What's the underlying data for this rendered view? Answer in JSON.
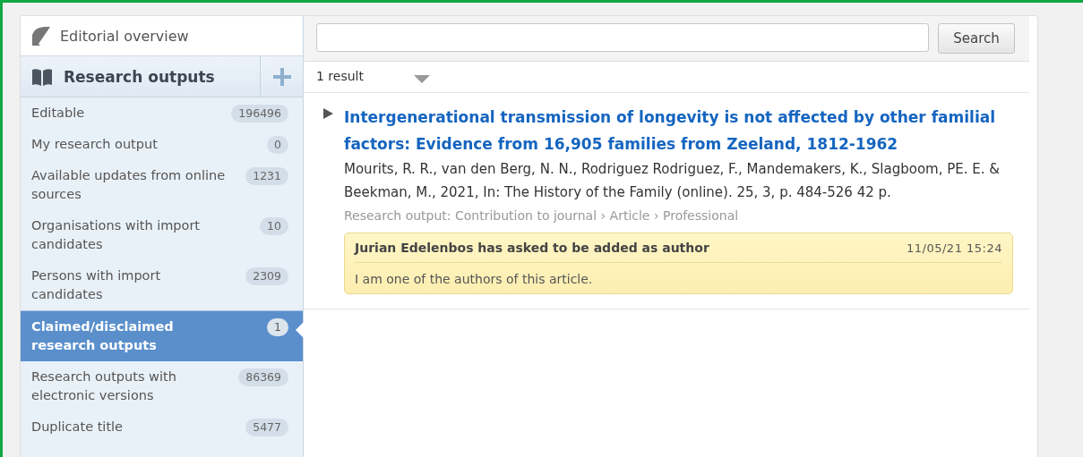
{
  "sidebar": {
    "overview": {
      "label": "Editorial overview"
    },
    "section": {
      "title": "Research outputs"
    },
    "items": [
      {
        "label": "Editable",
        "count": "196496",
        "selected": false
      },
      {
        "label": "My research output",
        "count": "0",
        "selected": false
      },
      {
        "label": "Available updates from online sources",
        "count": "1231",
        "selected": false
      },
      {
        "label": "Organisations with import candidates",
        "count": "10",
        "selected": false
      },
      {
        "label": "Persons with import candidates",
        "count": "2309",
        "selected": false
      },
      {
        "label": "Claimed/disclaimed research outputs",
        "count": "1",
        "selected": true
      },
      {
        "label": "Research outputs with electronic versions",
        "count": "86369",
        "selected": false
      },
      {
        "label": "Duplicate title",
        "count": "5477",
        "selected": false
      }
    ]
  },
  "search": {
    "button": "Search"
  },
  "results": {
    "count": "1 result",
    "items": [
      {
        "title": "Intergenerational transmission of longevity is not affected by other familial factors: Evidence from 16,905 families from Zeeland, 1812-1962",
        "citation": "Mourits, R. R., van den Berg, N. N., Rodriguez Rodriguez, F., Mandemakers, K., Slagboom, PE. E. & Beekman, M., 2021, In: The History of the Family (online). 25, 3, p. 484-526 42 p.",
        "type": "Research output: Contribution to journal › Article › Professional",
        "expanded": false,
        "note": {
          "heading": "Jurian Edelenbos has asked to be added as author",
          "time": "11/05/21 15:24",
          "message": "I am one of the authors of this article."
        }
      }
    ]
  }
}
